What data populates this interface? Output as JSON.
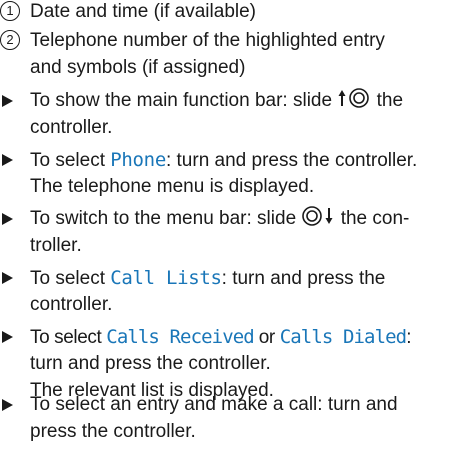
{
  "colors": {
    "text": "#1a1a1a",
    "highlight": "#1976b8"
  },
  "legend": [
    {
      "number": "1",
      "lines": [
        "Date and time (if available)"
      ]
    },
    {
      "number": "2",
      "lines": [
        "Telephone number of the highlighted entry",
        "and symbols (if assigned)"
      ]
    }
  ],
  "steps": {
    "s1": {
      "a": "To show the main function bar: slide",
      "b": "the",
      "c": "controller.",
      "icon": "slide-up-controller-icon"
    },
    "s2": {
      "a": "To select",
      "hl": "Phone",
      "b": ": turn and press the controller.",
      "c": "The telephone menu is displayed."
    },
    "s3": {
      "a": "To switch to the menu bar: slide",
      "b": "the con-",
      "c": "troller.",
      "icon": "slide-down-controller-icon"
    },
    "s4": {
      "a": "To select",
      "hl": "Call Lists",
      "b": ": turn and press the",
      "c": "controller."
    },
    "s5": {
      "a": "To select",
      "hl1": "Calls Received",
      "or": "or",
      "hl2": "Calls Dialed",
      "colon": ":",
      "c": "turn and press the controller.",
      "d": "The relevant list is displayed."
    },
    "s6": {
      "a": "To select an entry and make a call: turn and",
      "b": "press the controller."
    }
  }
}
